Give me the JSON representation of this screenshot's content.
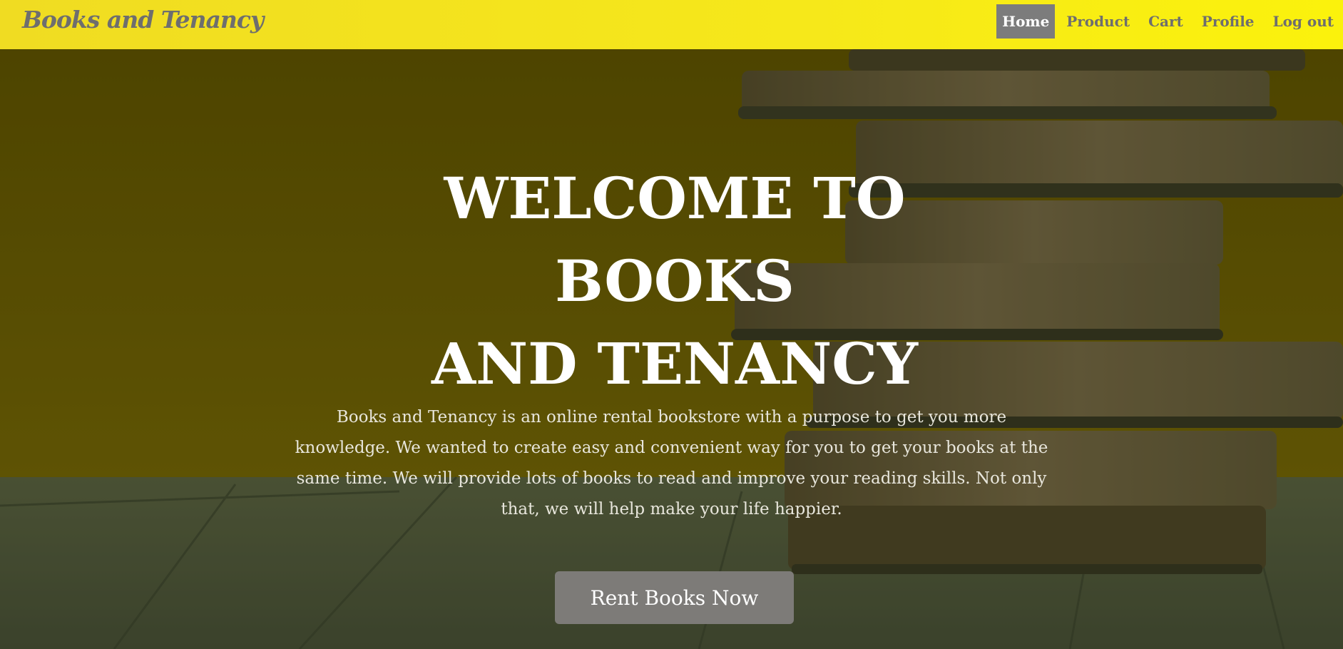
{
  "navbar": {
    "brand": "Books and Tenancy",
    "links": [
      {
        "label": "Home",
        "active": true
      },
      {
        "label": "Product",
        "active": false
      },
      {
        "label": "Cart",
        "active": false
      },
      {
        "label": "Profile",
        "active": false
      },
      {
        "label": "Log out",
        "active": false
      }
    ]
  },
  "hero": {
    "title_line1": "WELCOME TO BOOKS",
    "title_line2": "AND TENANCY",
    "description": "Books and Tenancy is an online rental bookstore with a purpose to get you more knowledge. We wanted to create easy and convenient way for you to get your books at the same time. We will provide lots of books to read and improve your reading skills. Not only that, we will help make your life happier.",
    "cta_label": "Rent Books Now"
  },
  "colors": {
    "navbar_yellow": "#f6e81a",
    "brand_gray": "#6e6e6e",
    "active_nav_bg": "#7c7c7c",
    "hero_overlay": "#4a4300",
    "cta_bg": "#7d7b78"
  }
}
